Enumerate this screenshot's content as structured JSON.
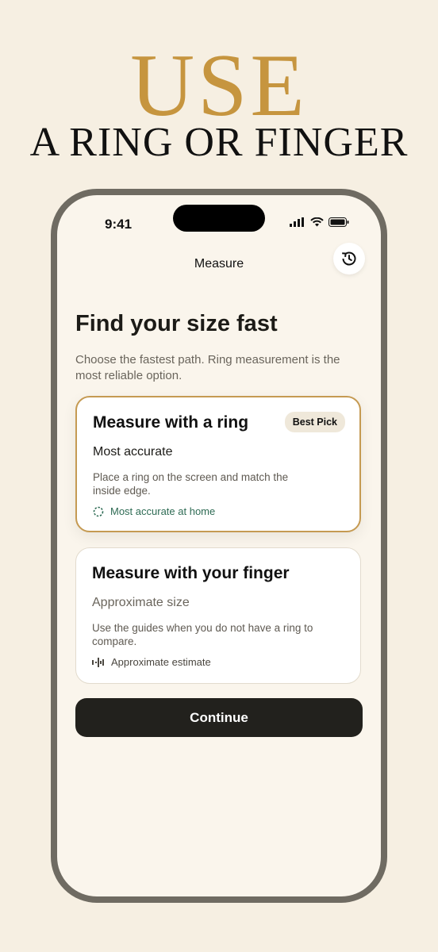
{
  "hero": {
    "line1": "USE",
    "line2": "A RING OR FINGER"
  },
  "status_bar": {
    "time": "9:41",
    "icons": [
      "cellular-signal-icon",
      "wifi-icon",
      "battery-icon"
    ]
  },
  "nav": {
    "title": "Measure",
    "history_icon": "history-icon"
  },
  "page": {
    "heading": "Find your size fast",
    "subtitle": "Choose the fastest path. Ring measurement is the most reliable option."
  },
  "options": [
    {
      "title": "Measure with a ring",
      "badge": "Best Pick",
      "subtitle": "Most accurate",
      "description": "Place a ring on the screen and match the inside edge.",
      "tag": "Most accurate at home",
      "tag_icon": "dashed-circle-icon",
      "selected": true
    },
    {
      "title": "Measure with your finger",
      "subtitle": "Approximate size",
      "description": "Use the guides when you do not have a ring to compare.",
      "tag": "Approximate estimate",
      "tag_icon": "waveform-icon",
      "selected": false
    }
  ],
  "continue_label": "Continue",
  "colors": {
    "background": "#f6efe2",
    "accent_gold": "#c6953f",
    "phone_frame": "#6f6b62",
    "button_dark": "#22211d",
    "tag_green": "#2e6b54"
  }
}
